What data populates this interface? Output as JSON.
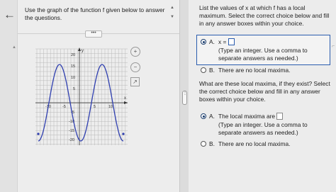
{
  "nav": {
    "back_icon": "←"
  },
  "left": {
    "question": "Use the graph of the function f given below to answer the questions.",
    "expander": "•••",
    "graph": {
      "y_label": "y",
      "x_label": "x",
      "x_ticks": [
        "-10",
        "-5",
        "5",
        "10"
      ],
      "y_ticks": [
        "20",
        "15",
        "10",
        "5",
        "-5",
        "-10",
        "-15",
        "-20"
      ]
    },
    "tools": {
      "zoom_in": "+",
      "zoom_out": "−",
      "popout": "↗"
    }
  },
  "right": {
    "q1": "List the values of x at which f has a local maximum. Select the correct choice below and fill in any answer boxes within your choice.",
    "q1_a_letter": "A.",
    "q1_a_prefix": "x =",
    "q1_a_hint": "(Type an integer. Use a comma to separate answers as needed.)",
    "q1_b_letter": "B.",
    "q1_b_text": "There are no local maxima.",
    "q2": "What are these local maxima, if they exist? Select the correct choice below and fill in any answer boxes within your choice.",
    "q2_a_letter": "A.",
    "q2_a_text": "The local maxima are",
    "q2_a_hint": "(Type an integer. Use a comma to separate answers as needed.)",
    "q2_b_letter": "B.",
    "q2_b_text": "There are no local maxima."
  },
  "colors": {
    "curve": "#2f3fb0",
    "accent": "#2a5cae",
    "selected": "#1a3c6c"
  }
}
